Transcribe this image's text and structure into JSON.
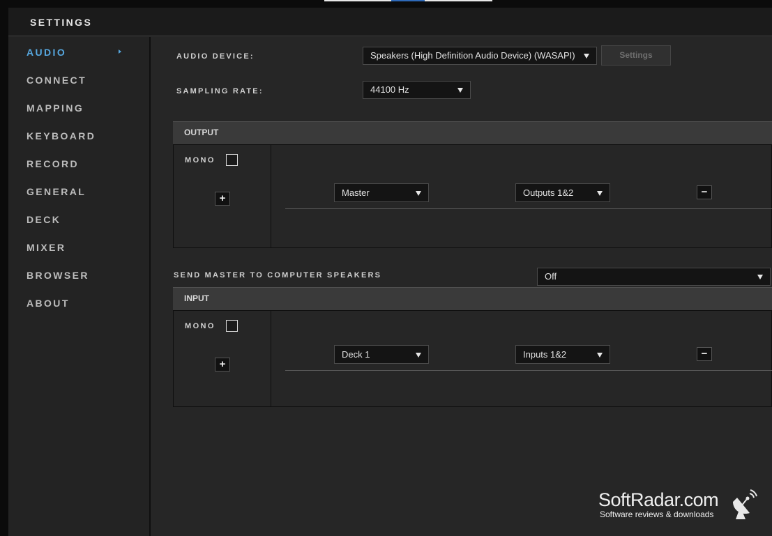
{
  "window": {
    "title": "SETTINGS"
  },
  "sidebar": {
    "items": [
      {
        "label": "AUDIO",
        "active": true
      },
      {
        "label": "CONNECT"
      },
      {
        "label": "MAPPING"
      },
      {
        "label": "KEYBOARD"
      },
      {
        "label": "RECORD"
      },
      {
        "label": "GENERAL"
      },
      {
        "label": "DECK"
      },
      {
        "label": "MIXER"
      },
      {
        "label": "BROWSER"
      },
      {
        "label": "ABOUT"
      }
    ]
  },
  "audio": {
    "device_label": "AUDIO DEVICE:",
    "device_value": "Speakers (High Definition Audio Device) (WASAPI)",
    "settings_button": "Settings",
    "sampling_label": "SAMPLING RATE:",
    "sampling_value": "44100 Hz"
  },
  "output": {
    "header": "OUTPUT",
    "mono_label": "MONO",
    "add_symbol": "+",
    "remove_symbol": "−",
    "channel_value": "Master",
    "port_value": "Outputs 1&2"
  },
  "send_master": {
    "label": "SEND MASTER TO COMPUTER SPEAKERS",
    "value": "Off"
  },
  "input": {
    "header": "INPUT",
    "mono_label": "MONO",
    "add_symbol": "+",
    "remove_symbol": "−",
    "channel_value": "Deck 1",
    "port_value": "Inputs 1&2"
  },
  "watermark": {
    "name": "SoftRadar.com",
    "tagline": "Software reviews & downloads"
  },
  "colors": {
    "accent": "#57a8e0",
    "background": "#262626",
    "sidebar": "#232323",
    "section_header": "#3a3a3a"
  }
}
